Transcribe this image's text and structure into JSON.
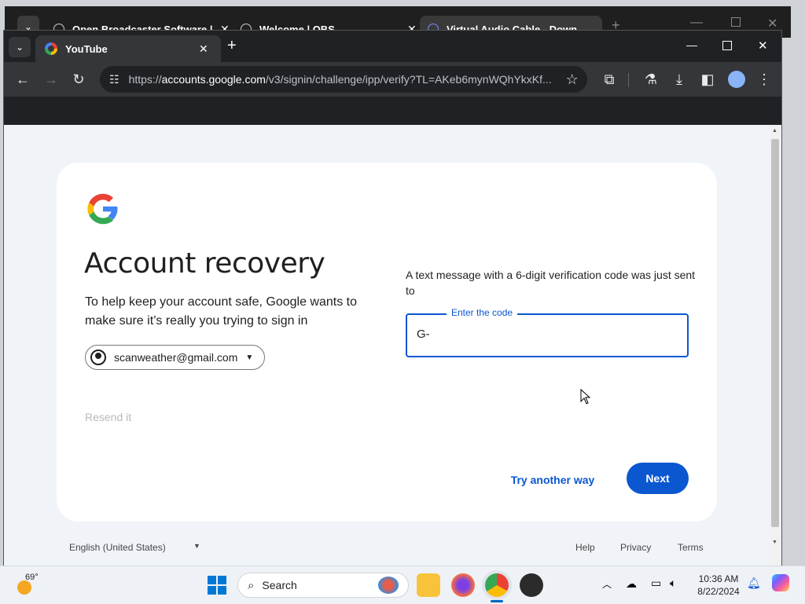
{
  "back_window": {
    "tabs": [
      {
        "title": "Open Broadcaster Software | C",
        "icon": "obs-icon"
      },
      {
        "title": "Welcome | OBS",
        "icon": "globe-icon"
      },
      {
        "title": "Virtual Audio Cable - Downloa",
        "icon": "vac-icon"
      }
    ]
  },
  "browser": {
    "active_tab_title": "YouTube",
    "url_prefix": "https://",
    "url_host": "accounts.google.com",
    "url_path": "/v3/signin/challenge/ipp/verify?TL=AKeb6mynWQhYkxKf..."
  },
  "page": {
    "title": "Account recovery",
    "subtitle": "To help keep your account safe, Google wants to make sure it’s really you trying to sign in",
    "account_email": "scanweather@gmail.com",
    "resend_link": "Resend it",
    "instruction": "A text message with a 6-digit verification code was just sent to",
    "code_label": "Enter the code",
    "code_value": "G-",
    "try_another": "Try another way",
    "next": "Next",
    "colors": {
      "primary": "#0b57d0",
      "background": "#f0f4f9"
    }
  },
  "footer": {
    "language": "English (United States)",
    "links": [
      "Help",
      "Privacy",
      "Terms"
    ]
  },
  "taskbar": {
    "weather": "69°",
    "search_placeholder": "Search",
    "time": "10:36 AM",
    "date": "8/22/2024"
  }
}
